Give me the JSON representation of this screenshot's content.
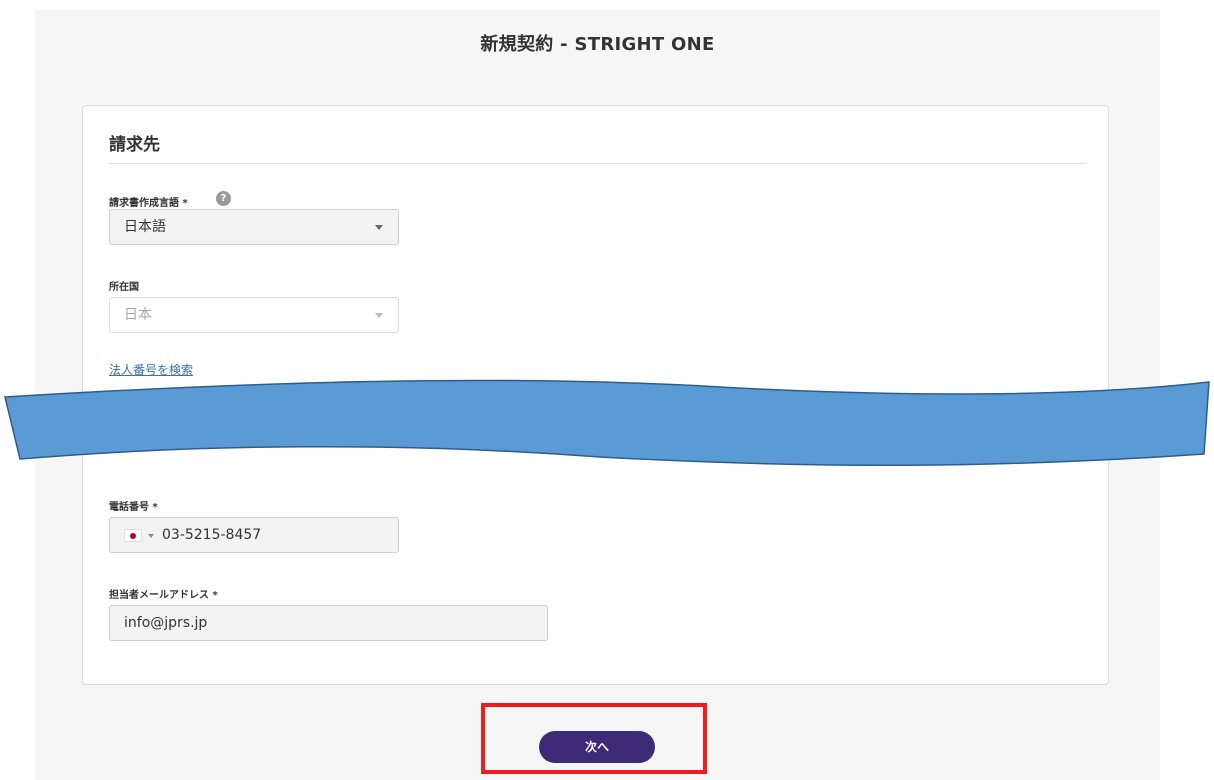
{
  "page": {
    "title": "新規契約 - STRIGHT ONE"
  },
  "billing_section": {
    "title": "請求先",
    "invoice_language": {
      "label": "請求書作成言語 *",
      "help_icon": "question-circle-icon",
      "value": "日本語"
    },
    "country": {
      "label": "所在国",
      "value": "日本",
      "disabled": true
    },
    "corporate_number_link": "法人番号を検索",
    "phone": {
      "label": "電話番号 *",
      "country_flag_icon": "japan-flag-icon",
      "value": "03-5215-8457"
    },
    "email": {
      "label": "担当者メールアドレス *",
      "value": "info@jprs.jp"
    }
  },
  "actions": {
    "next_label": "次へ"
  },
  "annotations": {
    "redaction_color": "#5b9bd5",
    "highlight_color": "#ee1c1c"
  }
}
